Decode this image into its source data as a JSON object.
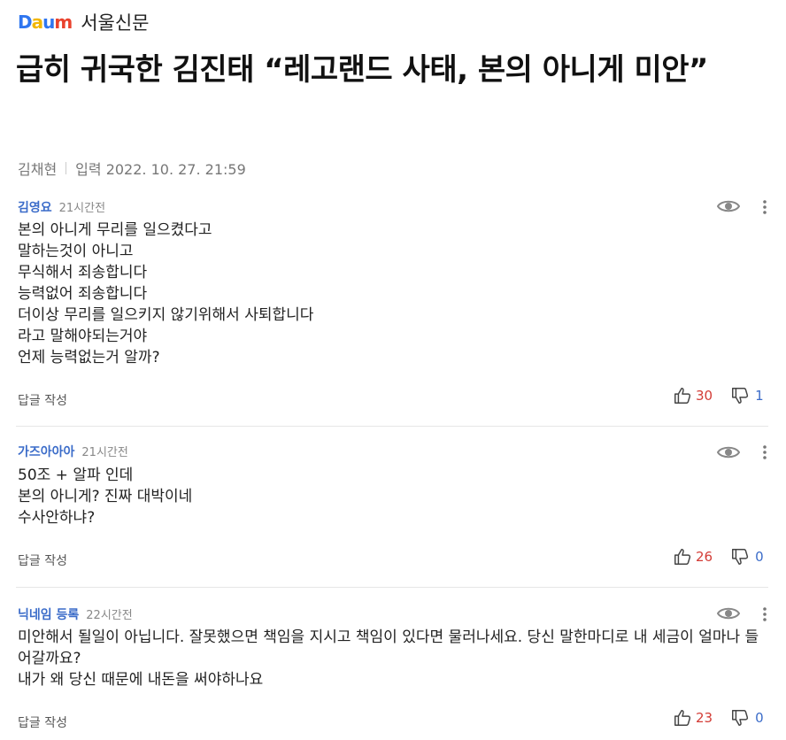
{
  "header": {
    "logo_text": "Daum",
    "press_name": "서울신문"
  },
  "article": {
    "title": "급히 귀국한 김진태 “레고랜드 사태, 본의 아니게 미안”",
    "author": "김채현",
    "published": "입력 2022. 10. 27. 21:59"
  },
  "comments": [
    {
      "author": "김영요",
      "time": "21시간전",
      "body": "본의 아니게 무리를 일으켰다고\n말하는것이 아니고\n무식해서 죄송합니다\n능력없어 죄송합니다\n더이상 무리를  일으키지 않기위해서  사퇴합니다\n라고  말해야되는거야\n언제  능력없는거  알까?",
      "reply_label": "답글 작성",
      "likes": "30",
      "dislikes": "1"
    },
    {
      "author": "가즈아아아",
      "time": "21시간전",
      "body": "50조 + 알파 인데\n본의 아니게? 진짜 대박이네\n수사안하냐?",
      "reply_label": "답글 작성",
      "likes": "26",
      "dislikes": "0"
    },
    {
      "author": "닉네임 등록",
      "time": "22시간전",
      "body": "미안해서 될일이 아닙니다. 잘못했으면 책임을 지시고 책임이 있다면 물러나세요. 당신 말한마디로 내 세금이 얼마나 들어갈까요?\n내가 왜 당신 때문에 내돈을 써야하나요",
      "reply_label": "답글 작성",
      "likes": "23",
      "dislikes": "0"
    }
  ],
  "colors": {
    "like": "#d33c36",
    "dislike": "#3b6cc9",
    "author": "#3b6cc9"
  },
  "icons": [
    "eye-icon",
    "more-icon",
    "thumbs-up-icon",
    "thumbs-down-icon"
  ]
}
